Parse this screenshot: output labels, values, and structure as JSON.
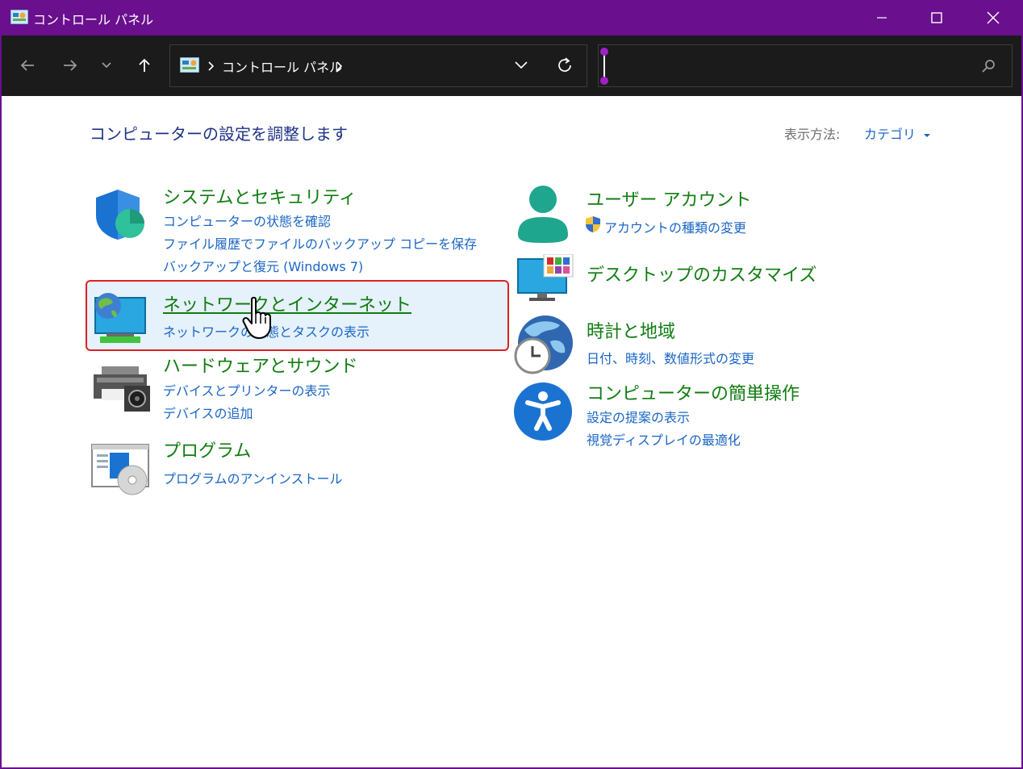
{
  "window": {
    "title": "コントロール パネル"
  },
  "toolbar": {
    "breadcrumb": [
      "コントロール パネル"
    ],
    "search_placeholder": ""
  },
  "main": {
    "heading": "コンピューターの設定を調整します",
    "view_by_label": "表示方法:",
    "view_by_value": "カテゴリ",
    "left": [
      {
        "title": "システムとセキュリティ",
        "links": [
          "コンピューターの状態を確認",
          "ファイル履歴でファイルのバックアップ コピーを保存",
          "バックアップと復元 (Windows 7)"
        ]
      },
      {
        "title": "ネットワークとインターネット",
        "links": [
          "ネットワークの状態とタスクの表示"
        ]
      },
      {
        "title": "ハードウェアとサウンド",
        "links": [
          "デバイスとプリンターの表示",
          "デバイスの追加"
        ]
      },
      {
        "title": "プログラム",
        "links": [
          "プログラムのアンインストール"
        ]
      }
    ],
    "right": [
      {
        "title": "ユーザー アカウント",
        "links": [
          "アカウントの種類の変更"
        ]
      },
      {
        "title": "デスクトップのカスタマイズ",
        "links": []
      },
      {
        "title": "時計と地域",
        "links": [
          "日付、時刻、数値形式の変更"
        ]
      },
      {
        "title": "コンピューターの簡単操作",
        "links": [
          "設定の提案の表示",
          "視覚ディスプレイの最適化"
        ]
      }
    ]
  },
  "colors": {
    "titlebar": "#6a0f8e",
    "toolbar": "#1b1b1b",
    "category_title": "#107c10",
    "link": "#1a66c4",
    "heading": "#1e3287",
    "highlight_border": "#e02020"
  }
}
